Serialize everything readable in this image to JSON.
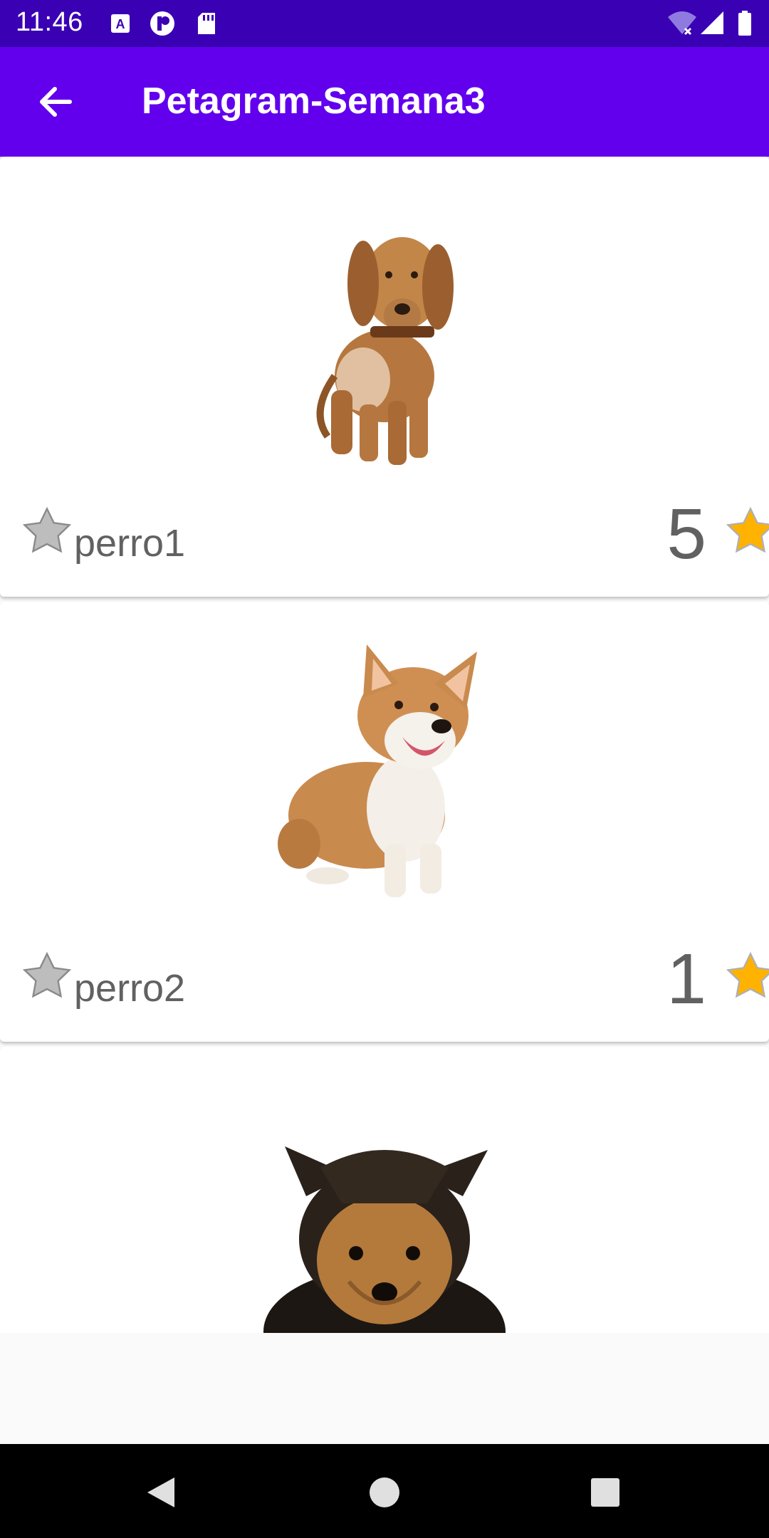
{
  "status_bar": {
    "time": "11:46",
    "icons_left": [
      "a-notification-icon",
      "pocket-icon",
      "sd-card-icon"
    ],
    "icons_right": [
      "wifi-no-internet-icon",
      "cellular-signal-icon",
      "battery-icon"
    ],
    "background": "#3a00b4"
  },
  "app_bar": {
    "title": "Petagram-Semana3",
    "back_icon": "arrow-back-icon",
    "background": "#6200ee"
  },
  "pets": [
    {
      "name": "perro1",
      "rating": "5",
      "photo": "dachshund"
    },
    {
      "name": "perro2",
      "rating": "1",
      "photo": "corgi"
    },
    {
      "name": "",
      "rating": "",
      "photo": "yorkshire-puppy"
    }
  ],
  "colors": {
    "like_star": "#bdbdbd",
    "rating_star": "#ffb300",
    "text": "#616161"
  },
  "nav_bar": {
    "buttons": [
      "back-triangle-icon",
      "home-circle-icon",
      "recents-square-icon"
    ]
  }
}
